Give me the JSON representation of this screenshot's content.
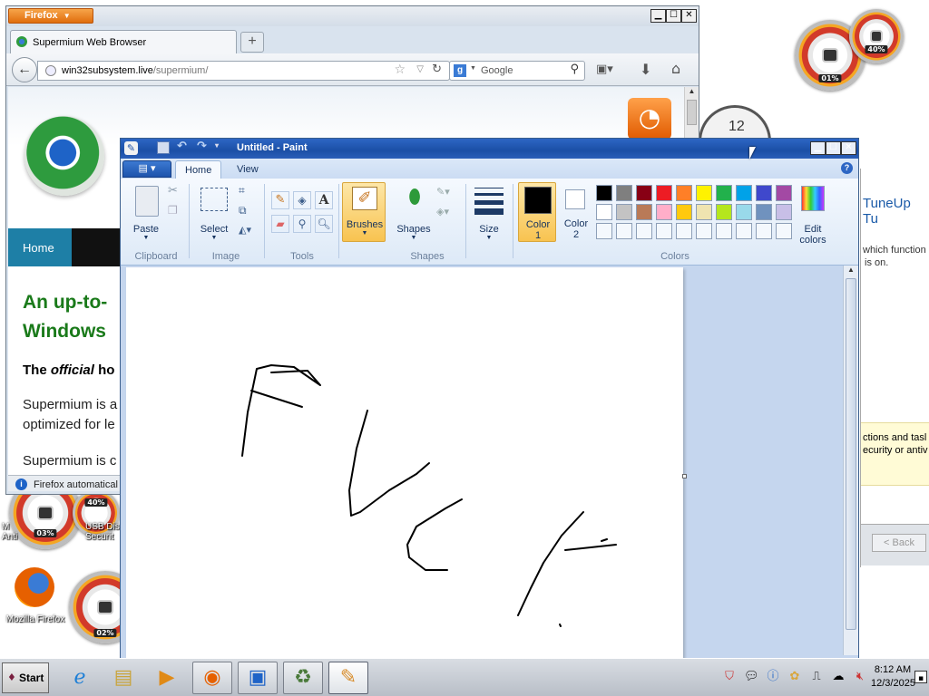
{
  "firefox": {
    "menu_button": "Firefox",
    "tab_title": "Supermium Web Browser",
    "url_domain": "win32subsystem.live",
    "url_path": "/supermium/",
    "search_placeholder": "Google",
    "nav_home": "Home",
    "heading_line1": "An up-to-",
    "heading_line2": "Windows",
    "para1_pre": "The ",
    "para1_em": "official",
    "para1_post": " ho",
    "para2_line1": "Supermium is a",
    "para2_line2": "optimized for le",
    "para3": "Supermium is c",
    "notification": "Firefox automatical"
  },
  "background_window": {
    "title": "TuneUp Tu",
    "text_line1": "which function",
    "text_line2": "is on.",
    "notice_line1": "ctions and tasl",
    "notice_line2": "ecurity or antiv",
    "back_button": "< Back"
  },
  "paint": {
    "title": "Untitled - Paint",
    "file_button": "▤ ▾",
    "tabs": [
      "Home",
      "View"
    ],
    "clipboard": {
      "paste": "Paste",
      "group": "Clipboard"
    },
    "image": {
      "select": "Select",
      "group": "Image"
    },
    "tools": {
      "group": "Tools"
    },
    "brushes": "Brushes",
    "shapes": {
      "label": "Shapes",
      "group": "Shapes"
    },
    "size": "Size",
    "color1": {
      "line1": "Color",
      "line2": "1"
    },
    "color2": {
      "line1": "Color",
      "line2": "2"
    },
    "edit_colors": {
      "line1": "Edit",
      "line2": "colors"
    },
    "colors_group": "Colors",
    "palette_row1": [
      "#000000",
      "#7f7f7f",
      "#880015",
      "#ed1c24",
      "#ff7f27",
      "#fff200",
      "#22b14c",
      "#00a2e8",
      "#3f48cc",
      "#a349a4"
    ],
    "palette_row2": [
      "#ffffff",
      "#c3c3c3",
      "#b97a57",
      "#ffaec9",
      "#ffc90e",
      "#efe4b0",
      "#b5e61d",
      "#99d9ea",
      "#7092be",
      "#c8bfe7"
    ],
    "color1_value": "#000000",
    "color2_value": "#ffffff"
  },
  "desktop": {
    "gauge_top_main": "01%",
    "gauge_top_small": "40%",
    "gauge_left_main": "03%",
    "gauge_left_small": "40%",
    "gauge_bottom": "02%",
    "label_left_a": "M\nAnti",
    "label_usb": "USB Dis\nSecurit",
    "label_firefox": "Mozilla Firefox",
    "clock_numeral": "12"
  },
  "taskbar": {
    "start": "Start",
    "time": "8:12 AM",
    "date": "12/3/2025"
  }
}
